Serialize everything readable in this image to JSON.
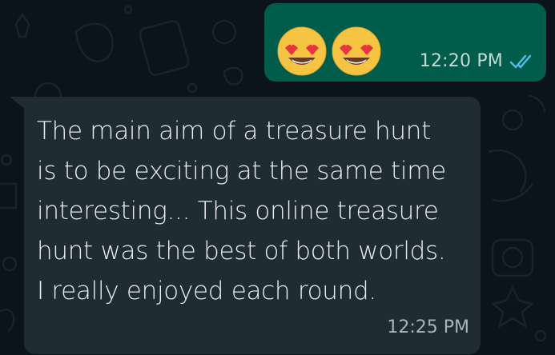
{
  "outgoing_message": {
    "emojis": [
      "heart-eyes-emoji",
      "heart-eyes-emoji"
    ],
    "time": "12:20 PM",
    "status_icon": "double-check-read-icon",
    "status_color": "#53bdeb"
  },
  "incoming_message": {
    "lines": [
      "The main aim of a treasure hunt",
      "is to be exciting at the same time",
      "interesting... This online treasure",
      "hunt was the best of both worlds.",
      "I really enjoyed each round."
    ],
    "time": "12:25 PM"
  },
  "colors": {
    "background": "#0b141a",
    "outgoing_bubble": "#005c4b",
    "incoming_bubble": "#202c33",
    "text": "#e9edef"
  }
}
